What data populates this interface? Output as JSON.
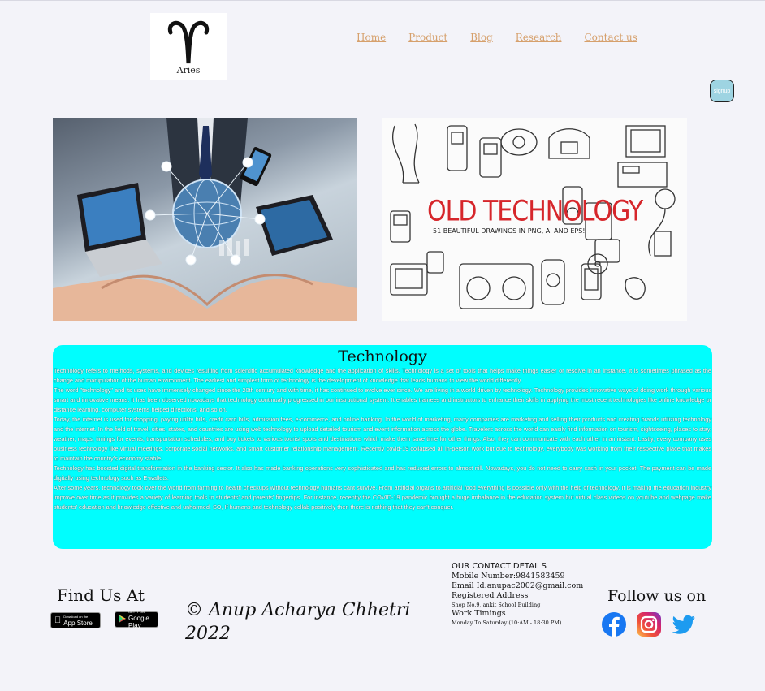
{
  "logo": {
    "text": "Aries"
  },
  "nav": {
    "items": [
      "Home",
      "Product",
      "Blog",
      "Research",
      "Contact us"
    ]
  },
  "signup": {
    "label": "signup"
  },
  "images": {
    "old_technology": {
      "title": "OLD TECHNOLOGY",
      "subtitle": "51 BEAUTIFUL DRAWINGS IN PNG, AI AND EPS!"
    }
  },
  "tech": {
    "heading": "Technology",
    "paragraphs": [
      "Technology refers to methods, systems, and devices resulting from scientific accumulated knowledge and the application of skills. Technology is a set of tools that helps make things easier or resolve in an instance. It is sometimes phrased as the change and manipulation of the human environment. The earliest and simplest form of technology is the development of knowledge that leads humans to view the world differently.",
      "The word \"technology\" and its uses have immensely changed since the 20th century and with time, it has continued to evolve ever since. We are living in a world driven by technology. Technology provides innovative ways of doing work through various smart and innovative means. It has been observed nowadays that technology continually progressed in our instructional system. It enables trainees and instructors to enhance their skills in applying the most recent technologies like online knowledge or distance learning, computer systems helped directions, and so on.",
      "Today, the internet is used for shopping, paying utility bills, credit card bills, admission fees, e-commerce, and online banking. In the world of marketing, many companies are marketing and selling their products and creating brands utilizing technology and the internet. In the field of travel, cities, states, and countries are using web technology to upload detailed tourism and event information across the globe. Travelers across the world can easily find information on tourism, sightseeing, places to stay, weather, maps, timings for events, transportation schedules, and buy tickets to various tourist spots and destinations which make them save time for other things. Also, they can communicate with each other in an instant. Lastly, every company uses business technology like virtual meetings, corporate social networks, and smart customer relationship management. Recently covid-19 collapsed all in-person work but due to technology, everybody was working from their respective place that makes to maintain the country's economy stable.",
      "Technology has boosted digital transformation in the banking sector. It also has made banking operations very sophisticated and has reduced errors to almost nill. Nowadays, you do not need to carry cash in your pocket. The payment can be made digitally using technology such as E-wallets.",
      "After some years, technology took over the world from farming to health checkups without technology humans cant survive. From artificial organs to artificial food everything is possible only with the help of technology. It is making the education industry improve over time as it provides a variety of learning tools to students' and parents' fingertips. For instance, recently the COVID-19 pandemic brought a huge imbalance in the education system but virtual class videos on youtube and webpage make students' education and knowledge effective and unharmed. SO, If humans and technology collab positively then there is nothing that they can't conquer."
    ]
  },
  "footer": {
    "find_us": "Find Us At",
    "app_store": {
      "small": "Download on the",
      "big": "App Store"
    },
    "google_play": {
      "small": "GET IT ON",
      "big": "Google Play"
    },
    "copyright": "© Anup Acharya Chhetri 2022",
    "contact": {
      "heading": "OUR CONTACT DETAILS",
      "mobile": "Mobile Number:9841583459",
      "email": "Email Id:anupac2002@gmail.com",
      "address_label": "Registered Address",
      "address": "Shop No.9, ankit School Building",
      "timings_label": "Work Timings",
      "timings": "Monday To Saturday (10:AM - 18:30 PM)"
    },
    "follow": "Follow us on",
    "social_icons": [
      "facebook-icon",
      "instagram-icon",
      "twitter-icon"
    ]
  }
}
